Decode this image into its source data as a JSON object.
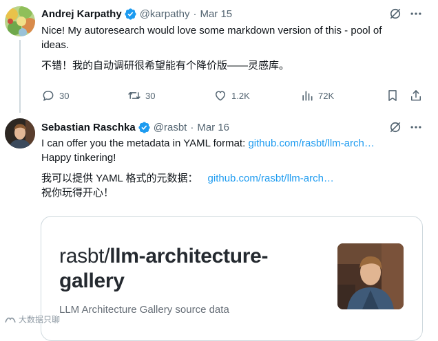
{
  "tweets": [
    {
      "author": "Andrej Karpathy",
      "handle": "@karpathy",
      "sep": "·",
      "date": "Mar 15",
      "lines": [
        "Nice! My autoresearch would love some markdown version of this - pool of",
        "ideas."
      ],
      "translation": "不错！我的自动调研很希望能有个降价版——灵感库。",
      "actions": {
        "replies": "30",
        "reposts": "30",
        "likes": "1.2K",
        "views": "72K"
      }
    },
    {
      "author": "Sebastian Raschka",
      "handle": "@rasbt",
      "sep": "·",
      "date": "Mar 16",
      "line1_text": "I can offer you the metadata in YAML format: ",
      "line1_link": "github.com/rasbt/llm-arch…",
      "line2": "Happy tinkering!",
      "translation_text": "我可以提供 YAML 格式的元数据：",
      "translation_link": "github.com/rasbt/llm-arch…",
      "translation_line2": "祝你玩得开心！",
      "card": {
        "title_prefix": "rasbt/",
        "title_bold_1": "llm-architecture-",
        "title_bold_2": "gallery",
        "description": "LLM Architecture Gallery source data"
      }
    }
  ],
  "watermark": "大数据只聊",
  "colors": {
    "text": "#0f1419",
    "muted": "#536471",
    "link": "#1d9bf0",
    "verified": "#1d9bf0",
    "thread_line": "#cfd9de"
  },
  "icons": {
    "verified": "verified-badge-icon",
    "grok": "grok-icon",
    "more": "more-icon",
    "reply": "reply-icon",
    "repost": "repost-icon",
    "like": "like-icon",
    "views": "views-icon",
    "bookmark": "bookmark-icon",
    "share": "share-icon"
  }
}
